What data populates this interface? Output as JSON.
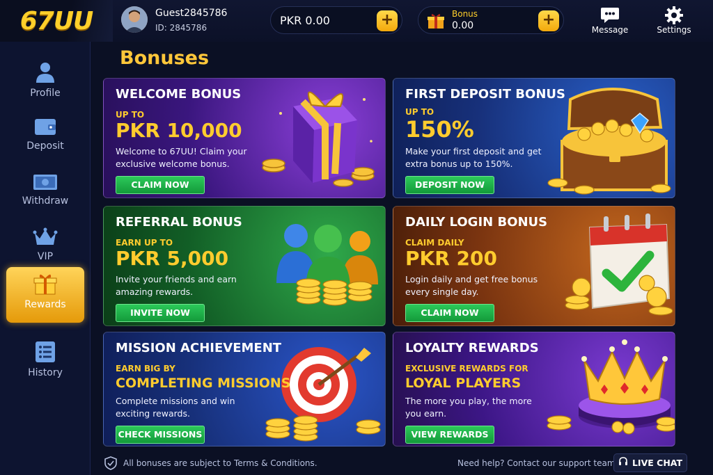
{
  "app": {
    "logo": "67UU"
  },
  "user": {
    "name": "Guest2845786",
    "id": "ID: 2845786"
  },
  "wallet": {
    "balance": "PKR 0.00",
    "bonus_label": "Bonus",
    "bonus_value": "0.00",
    "add": "+"
  },
  "topbar": {
    "message": "Message",
    "settings": "Settings"
  },
  "sidebar": {
    "items": [
      {
        "label": "Profile",
        "icon": "user-icon"
      },
      {
        "label": "Deposit",
        "icon": "wallet-icon"
      },
      {
        "label": "Withdraw",
        "icon": "cash-icon"
      },
      {
        "label": "VIP",
        "icon": "crown-icon"
      },
      {
        "label": "Rewards",
        "icon": "gift-icon",
        "active": true
      },
      {
        "label": "History",
        "icon": "list-icon"
      }
    ]
  },
  "page": {
    "title": "Bonuses"
  },
  "cards": {
    "welcome": {
      "title": "WELCOME BONUS",
      "sub": "UP TO",
      "amount": "PKR 10,000",
      "desc": "Welcome to 67UU! Claim your exclusive welcome bonus.",
      "button": "CLAIM NOW"
    },
    "deposit": {
      "title": "FIRST DEPOSIT BONUS",
      "sub": "UP TO",
      "amount": "150%",
      "desc": "Make your first deposit and get extra bonus up to 150%.",
      "button": "DEPOSIT NOW"
    },
    "referral": {
      "title": "REFERRAL BONUS",
      "sub": "EARN UP TO",
      "amount": "PKR 5,000",
      "desc": "Invite your friends and earn amazing rewards.",
      "button": "INVITE NOW"
    },
    "login": {
      "title": "DAILY LOGIN BONUS",
      "sub": "CLAIM DAILY",
      "amount": "PKR 200",
      "desc": "Login daily and get free bonus every single day.",
      "button": "CLAIM NOW"
    },
    "mission": {
      "title": "MISSION ACHIEVEMENT",
      "sub": "EARN BIG BY",
      "amount": "COMPLETING MISSIONS",
      "desc": "Complete missions and win exciting rewards.",
      "button": "CHECK MISSIONS"
    },
    "loyalty": {
      "title": "LOYALTY REWARDS",
      "sub": "EXCLUSIVE REWARDS FOR",
      "amount": "LOYAL PLAYERS",
      "desc": "The more you play, the more you earn.",
      "button": "VIEW REWARDS"
    }
  },
  "footer": {
    "terms": "All bonuses are subject to Terms & Conditions.",
    "help": "Need help? Contact our support team.",
    "live_chat": "LIVE CHAT"
  },
  "colors": {
    "accent": "#ffc73a",
    "button_green": "#1fb04a",
    "background": "#0b1024"
  }
}
